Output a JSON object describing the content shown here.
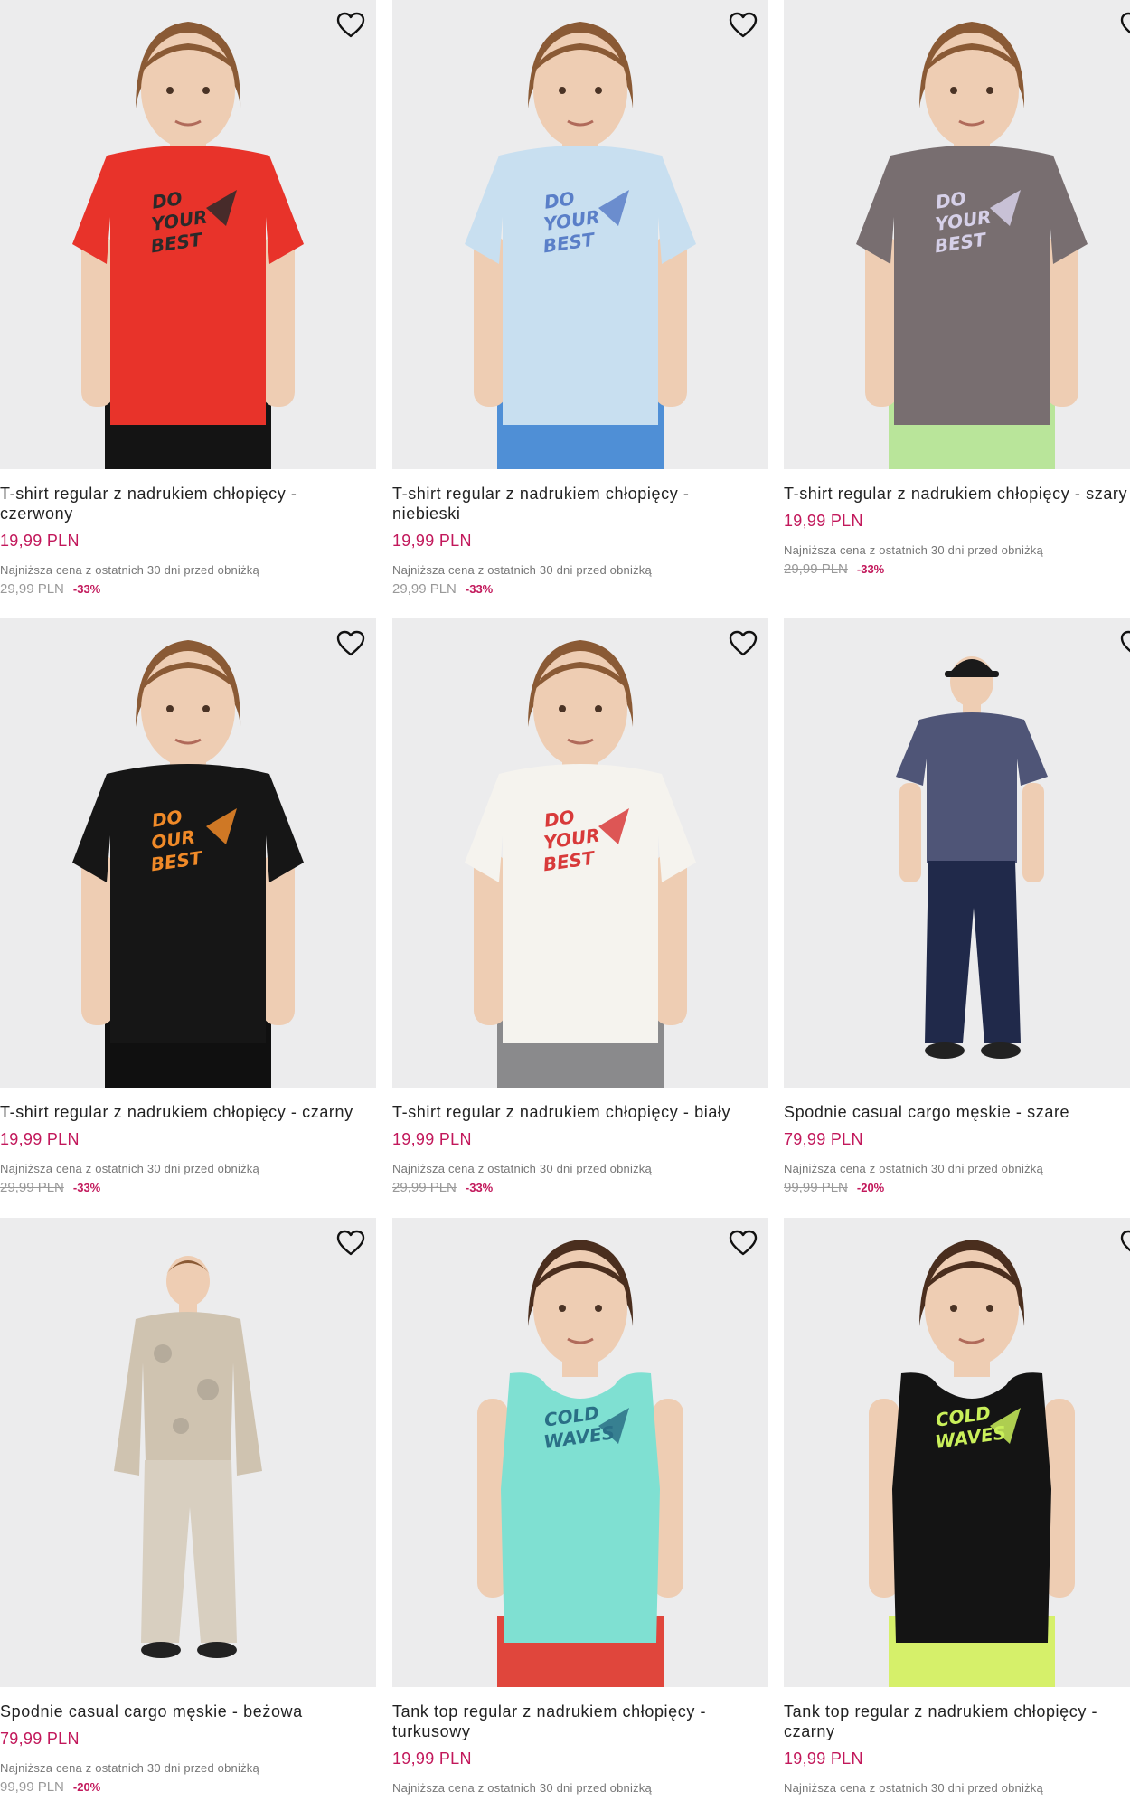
{
  "colors": {
    "price": "#c2185b",
    "background": "#ececed"
  },
  "products": [
    {
      "name": "T-shirt regular z nadrukiem chłopięcy - czerwony",
      "price": "19,99 PLN",
      "lowest_note": "Najniższa cena z ostatnich 30 dni przed obniżką",
      "old_price": "29,99 PLN",
      "discount": "-33%",
      "shirt_color": "#e8332a",
      "pants_color": "#141414",
      "print": "DO YOUR BEST",
      "print_color": "#2a2a2a"
    },
    {
      "name": "T-shirt regular z nadrukiem chłopięcy - niebieski",
      "price": "19,99 PLN",
      "lowest_note": "Najniższa cena z ostatnich 30 dni przed obniżką",
      "old_price": "29,99 PLN",
      "discount": "-33%",
      "shirt_color": "#c8dff0",
      "pants_color": "#4f8fd6",
      "print": "DO YOUR BEST",
      "print_color": "#5a7fc8"
    },
    {
      "name": "T-shirt regular z nadrukiem chłopięcy - szary",
      "price": "19,99 PLN",
      "lowest_note": "Najniższa cena z ostatnich 30 dni przed obniżką",
      "old_price": "29,99 PLN",
      "discount": "-33%",
      "shirt_color": "#786e70",
      "pants_color": "#b9e59a",
      "print": "DO YOUR BEST",
      "print_color": "#d6d0e8"
    },
    {
      "name": "T-shirt regular z nadrukiem chłopięcy - czarny",
      "price": "19,99 PLN",
      "lowest_note": "Najniższa cena z ostatnich 30 dni przed obniżką",
      "old_price": "29,99 PLN",
      "discount": "-33%",
      "shirt_color": "#161616",
      "pants_color": "#101010",
      "print": "DO OUR BEST",
      "print_color": "#f08a28"
    },
    {
      "name": "T-shirt regular z nadrukiem chłopięcy - biały",
      "price": "19,99 PLN",
      "lowest_note": "Najniższa cena z ostatnich 30 dni przed obniżką",
      "old_price": "29,99 PLN",
      "discount": "-33%",
      "shirt_color": "#f5f3ee",
      "pants_color": "#8a8a8c",
      "print": "DO YOUR BEST",
      "print_color": "#d83a3a"
    },
    {
      "name": "Spodnie casual cargo męskie - szare",
      "price": "79,99 PLN",
      "lowest_note": "Najniższa cena z ostatnich 30 dni przed obniżką",
      "old_price": "99,99 PLN",
      "discount": "-20%",
      "shirt_color": "#4f5577",
      "pants_color": "#20294a",
      "print": "",
      "print_color": "#20294a"
    },
    {
      "name": "Spodnie casual cargo męskie - beżowa",
      "price": "79,99 PLN",
      "lowest_note": "Najniższa cena z ostatnich 30 dni przed obniżką",
      "old_price": "99,99 PLN",
      "discount": "-20%",
      "shirt_color": "#cfc3b0",
      "pants_color": "#d8cfc0",
      "print": "",
      "print_color": "#9c9486"
    },
    {
      "name": "Tank top regular z nadrukiem chłopięcy - turkusowy",
      "price": "19,99 PLN",
      "lowest_note": "Najniższa cena z ostatnich 30 dni przed obniżką",
      "old_price": "",
      "discount": "",
      "shirt_color": "#7fe0d2",
      "pants_color": "#e0463c",
      "print": "COLD WAVES",
      "print_color": "#2a6f86"
    },
    {
      "name": "Tank top regular z nadrukiem chłopięcy - czarny",
      "price": "19,99 PLN",
      "lowest_note": "Najniższa cena z ostatnich 30 dni przed obniżką",
      "old_price": "",
      "discount": "",
      "shirt_color": "#141414",
      "pants_color": "#d6f06a",
      "print": "COLD WAVES",
      "print_color": "#c9ef5a"
    }
  ]
}
